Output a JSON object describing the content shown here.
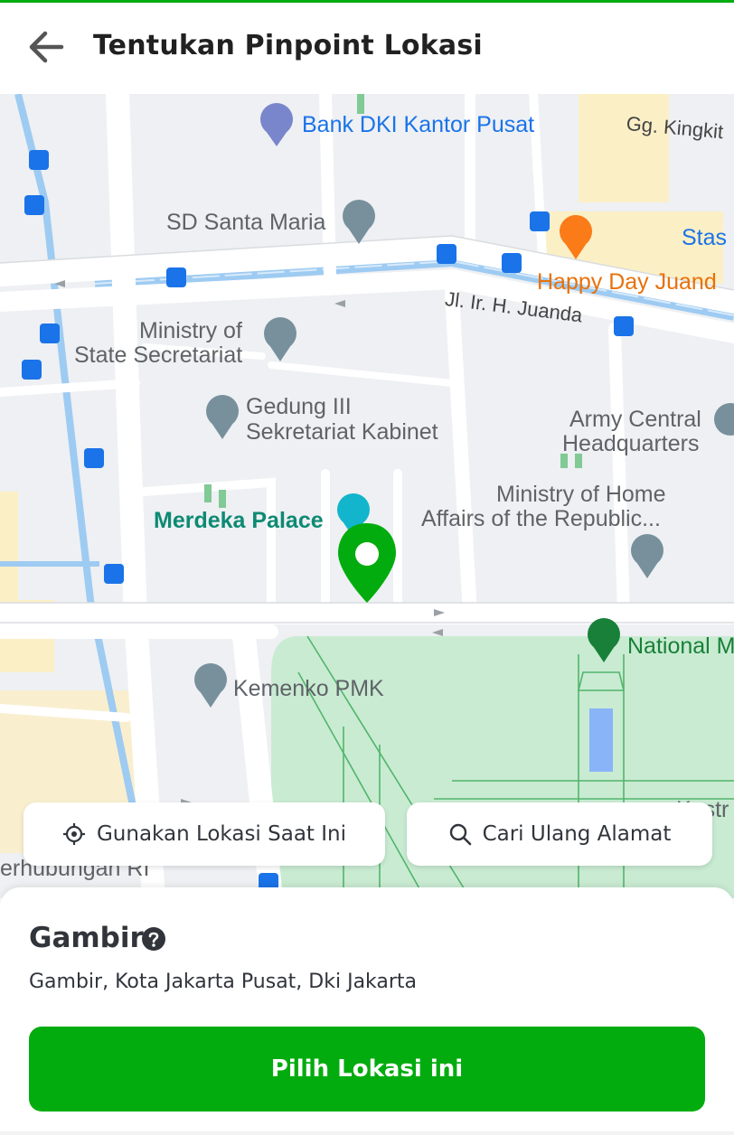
{
  "header": {
    "title": "Tentukan Pinpoint Lokasi",
    "back_icon": "arrow-left-icon"
  },
  "map": {
    "pois": {
      "bank_dki": "Bank DKI Kantor Pusat",
      "gg_kingkit": "Gg. Kingkit",
      "sd_santa_maria": "SD Santa Maria",
      "stas": "Stas",
      "happy_day": "Happy Day Juand",
      "ministry_state_line1": "Ministry of",
      "ministry_state_line2": "State Secretariat",
      "gedung_line1": "Gedung III",
      "gedung_line2": "Sekretariat Kabinet",
      "army_line1": "Army Central",
      "army_line2": "Headquarters",
      "ministry_home_line1": "Ministry of Home",
      "ministry_home_line2": "Affairs of the Republic...",
      "merdeka_palace": "Merdeka Palace",
      "national": "National M",
      "kemenko": "Kemenko PMK",
      "perhubungan": "erhubungan RI",
      "kostr": "Kostr",
      "street_juanda": "Jl. Ir. H. Juanda"
    },
    "colors": {
      "park": "#c9ebd2",
      "road": "#ffffff",
      "water": "#9ecbf2",
      "pin": "#03ac0e"
    }
  },
  "actions": {
    "use_current_location": "Gunakan Lokasi Saat Ini",
    "search_again": "Cari Ulang Alamat"
  },
  "location": {
    "name": "Gambir",
    "address": "Gambir, Kota Jakarta Pusat, Dki Jakarta",
    "confirm_label": "Pilih Lokasi ini"
  },
  "theme": {
    "primary": "#03ac0e",
    "text": "#31353b"
  }
}
